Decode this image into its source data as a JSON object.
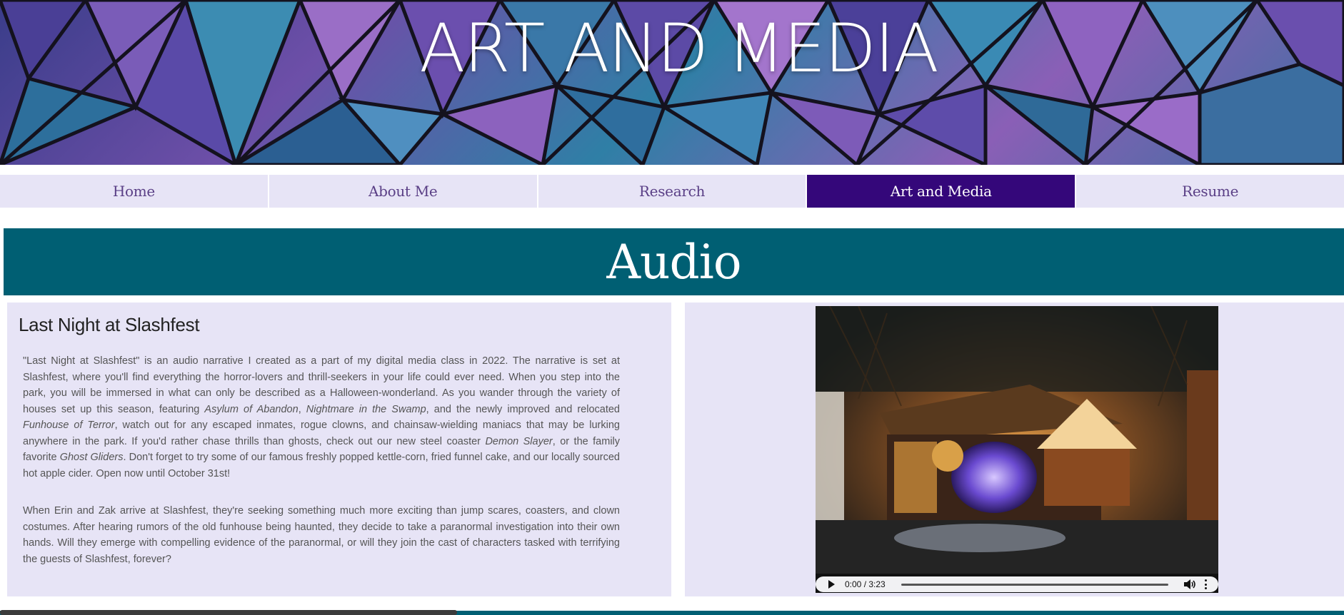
{
  "banner": {
    "title": "ART AND MEDIA"
  },
  "nav": {
    "items": [
      {
        "label": "Home"
      },
      {
        "label": "About Me"
      },
      {
        "label": "Research"
      },
      {
        "label": "Art and Media"
      },
      {
        "label": "Resume"
      }
    ],
    "active": "Art and Media"
  },
  "section": {
    "title": "Audio"
  },
  "article": {
    "title": "Last Night at Slashfest",
    "p1": {
      "s1": "\"Last Night at Slashfest\" is an audio narrative I created as a part of my digital media class in 2022. The narrative is set at Slashfest, where you'll find everything the horror-lovers and thrill-seekers in your life could ever need. When you step into the park, you will be immersed in what can only be described as a Halloween-wonderland. As you wander through the variety of houses set up this season, featuring ",
      "i1": "Asylum of Abandon",
      "s2": ", ",
      "i2": "Nightmare in the Swamp",
      "s3": ", and the newly improved and relocated ",
      "i3": "Funhouse of Terror",
      "s4": ", watch out for any escaped inmates, rogue clowns, and chainsaw-wielding maniacs that may be lurking anywhere in the park. If you'd rather chase thrills than ghosts, check out our new steel coaster ",
      "i4": "Demon Slayer",
      "s5": ", or the family favorite ",
      "i5": "Ghost Gliders",
      "s6": ". Don't forget to try some of our famous freshly popped kettle-corn, fried funnel cake, and our locally sourced hot apple cider. Open now until October 31st!"
    },
    "p2": "When Erin and Zak arrive at Slashfest, they're seeking something much more exciting than jump scares, coasters, and clown costumes. After hearing rumors of the old funhouse being haunted, they decide to take a paranormal investigation into their own hands. Will they emerge with compelling evidence of the paranormal, or will they join the cast of characters tasked with terrifying the guests of Slashfest, forever?"
  },
  "media": {
    "time": "0:00 / 3:23",
    "progress": 0,
    "icons": {
      "play": "play-icon",
      "volume": "volume-icon",
      "more": "more-options-icon"
    }
  },
  "colors": {
    "nav_bg": "#e7e4f6",
    "nav_active": "#34077a",
    "section_bg": "#005f73",
    "panel_bg": "#e7e4f6"
  }
}
